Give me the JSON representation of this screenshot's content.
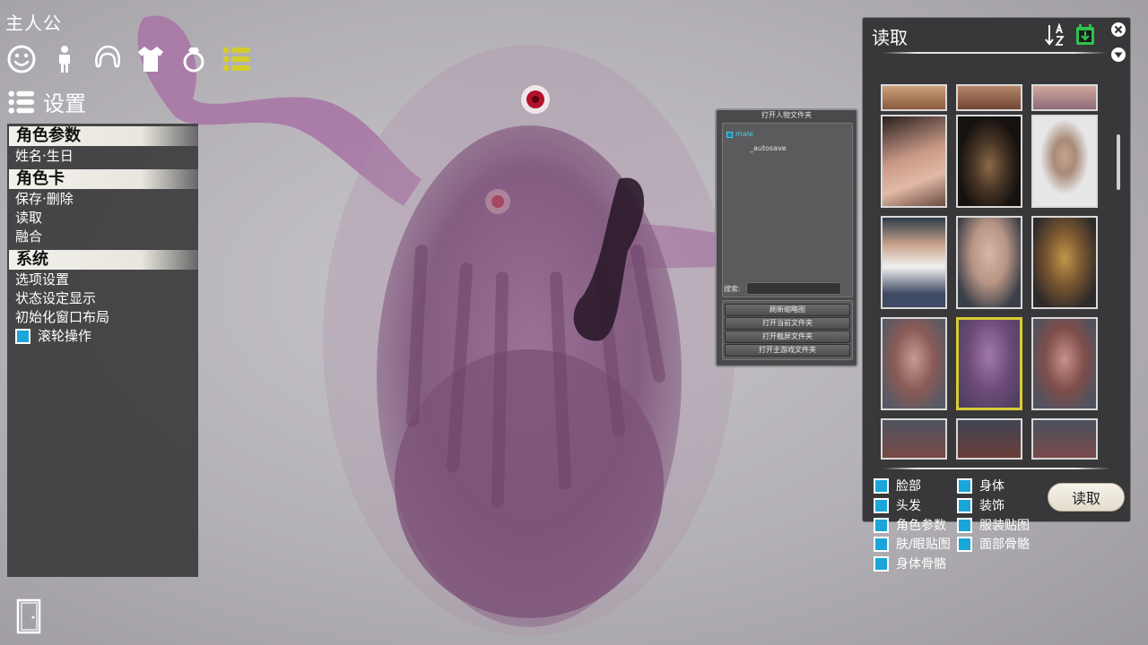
{
  "app_title": "主人公",
  "top_icons": [
    "face-icon",
    "body-icon",
    "hair-icon",
    "clothes-icon",
    "accessory-ring-icon",
    "settings-list-icon"
  ],
  "settings_header": {
    "label": "设置"
  },
  "left_menu": {
    "section_character_params": "角色参数",
    "item_name_birthday": "姓名·生日",
    "section_character_card": "角色卡",
    "item_save_delete": "保存·删除",
    "item_load": "读取",
    "item_merge": "融合",
    "section_system": "系统",
    "item_options": "选项设置",
    "item_status_display": "状态设定显示",
    "item_init_layout": "初始化窗口布局",
    "item_wheel_op": "滚轮操作"
  },
  "folder_panel": {
    "title": "打开人物文件夹",
    "tree_root": "male",
    "tree_child": "_autosave",
    "search_label": "搜索:",
    "search_value": "",
    "btn_refresh": "刷新缩略图",
    "btn_open_current": "打开当前文件夹",
    "btn_open_screenshot": "打开截屏文件夹",
    "btn_open_game": "打开主游戏文件夹"
  },
  "load_panel": {
    "title": "读取",
    "load_button": "读取",
    "options_left": [
      "脸部",
      "头发",
      "角色参数",
      "肤/眼贴图",
      "身体骨骼"
    ],
    "options_right": [
      "身体",
      "装饰",
      "服装贴图",
      "面部骨骼"
    ]
  },
  "colors": {
    "accent_cyan": "#1aa6d8",
    "selected_border": "#d9cc36",
    "panel_bg": "#3c3c3e",
    "active_icon": "#d4cc2e",
    "export_icon": "#2fc24a"
  }
}
